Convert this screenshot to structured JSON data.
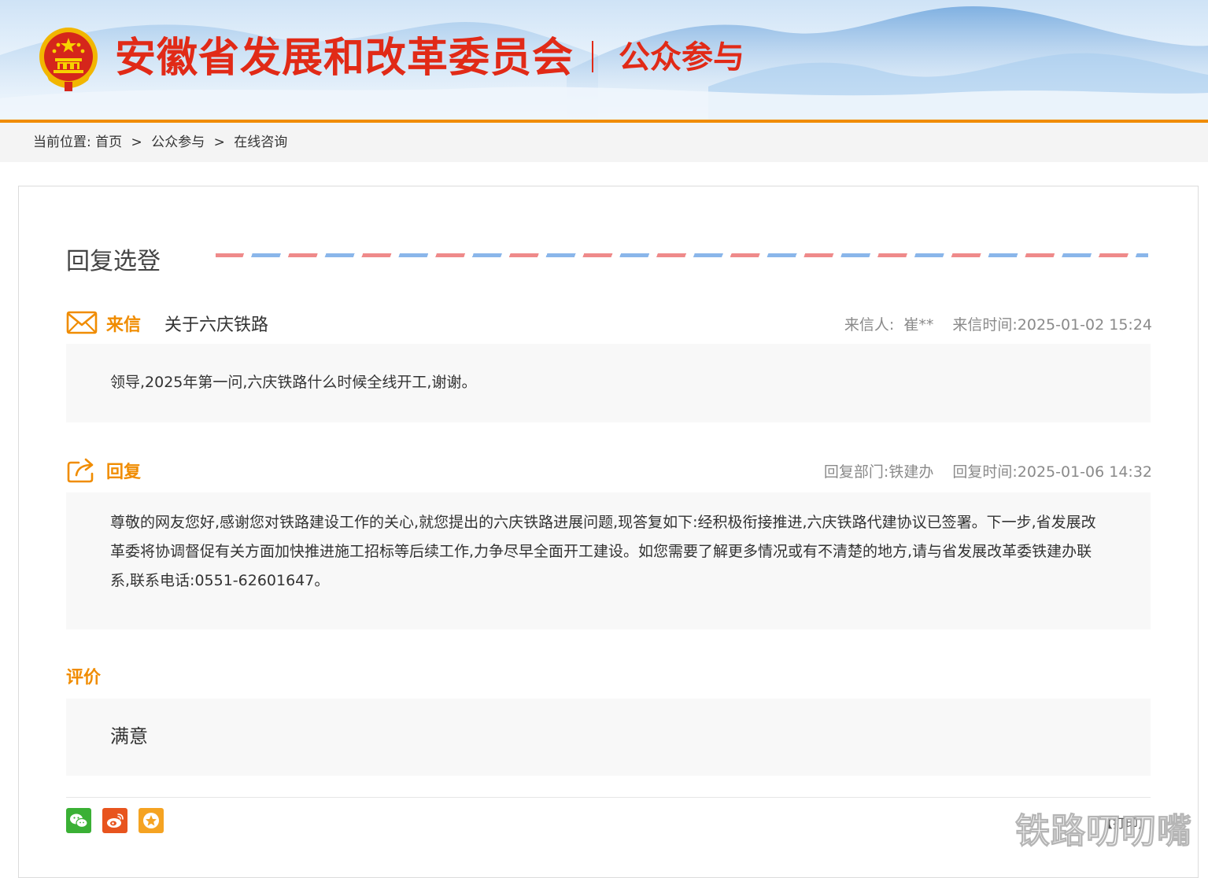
{
  "header": {
    "site_title": "安徽省发展和改革委员会",
    "section_title": "公众参与",
    "colors": {
      "brand_red": "#e12a17",
      "accent_orange": "#f08c00"
    }
  },
  "breadcrumb": {
    "label": "当前位置:",
    "items": [
      "首页",
      "公众参与",
      "在线咨询"
    ],
    "separator": ">"
  },
  "main": {
    "heading": "回复选登",
    "letter": {
      "icon": "envelope-icon",
      "tag": "来信",
      "subject": "关于六庆铁路",
      "sender_label": "来信人:",
      "sender": "崔**",
      "time_label": "来信时间:",
      "time": "2025-01-02 15:24",
      "content": "领导,2025年第一问,六庆铁路什么时候全线开工,谢谢。"
    },
    "reply": {
      "icon": "reply-share-icon",
      "tag": "回复",
      "dept_label": "回复部门:",
      "dept": "铁建办",
      "time_label": "回复时间:",
      "time": "2025-01-06 14:32",
      "content": "尊敬的网友您好,感谢您对铁路建设工作的关心,就您提出的六庆铁路进展问题,现答复如下:经积极衔接推进,六庆铁路代建协议已签署。下一步,省发展改革委将协调督促有关方面加快推进施工招标等后续工作,力争尽早全面开工建设。如您需要了解更多情况或有不清楚的地方,请与省发展改革委铁建办联系,联系电话:0551-62601647。"
    },
    "evaluation": {
      "tag": "评价",
      "value": "满意"
    }
  },
  "share": {
    "buttons": [
      {
        "icon": "wechat-icon",
        "color": "#3ab035"
      },
      {
        "icon": "weibo-icon",
        "color": "#e8541e"
      },
      {
        "icon": "favorite-star-icon",
        "color": "#f5a322"
      }
    ],
    "print_label": "【打印】"
  },
  "watermark": "铁路叨叨嘴"
}
